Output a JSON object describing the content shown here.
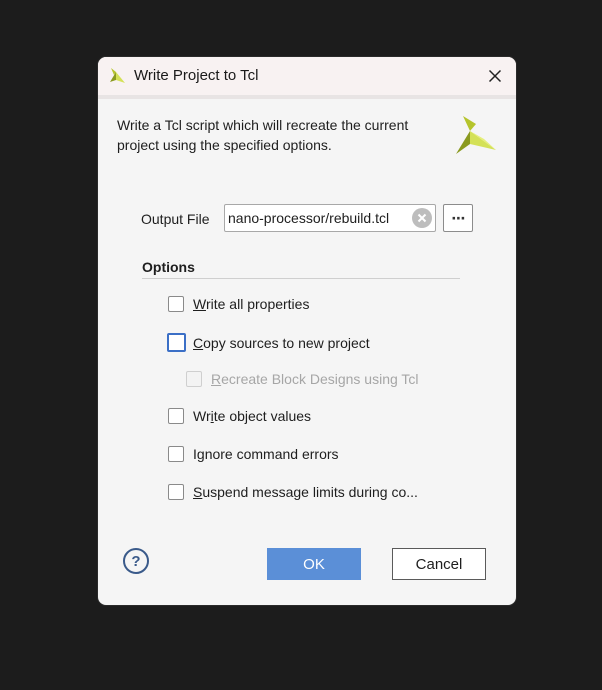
{
  "dialog": {
    "title": "Write Project to Tcl",
    "description": "Write a Tcl script which will recreate the current project using the specified options."
  },
  "output_file": {
    "label": "Output File",
    "value": "nano-processor/rebuild.tcl",
    "browse_label": "⋯"
  },
  "options": {
    "title": "Options",
    "items": [
      {
        "mnemonic": "W",
        "rest": "rite all properties",
        "checked": false,
        "enabled": true
      },
      {
        "mnemonic": "C",
        "rest": "opy sources to new project",
        "checked": false,
        "enabled": true,
        "focused": true
      },
      {
        "mnemonic": "R",
        "rest": "ecreate Block Designs using Tcl",
        "checked": false,
        "enabled": false
      },
      {
        "pre": "Wr",
        "mnemonic": "i",
        "rest": "te object values",
        "checked": false,
        "enabled": true
      },
      {
        "pre": "I",
        "mnemonic": "g",
        "rest": "nore command errors",
        "checked": false,
        "enabled": true
      },
      {
        "mnemonic": "S",
        "rest": "uspend message limits during co...",
        "checked": false,
        "enabled": true
      }
    ]
  },
  "footer": {
    "help_label": "?",
    "ok_label": "OK",
    "cancel_label": "Cancel"
  },
  "colors": {
    "accent": "#5b8fd7",
    "focus": "#3b6fc6",
    "logo_dark": "#8a9a1f",
    "logo_light": "#d4e157"
  }
}
